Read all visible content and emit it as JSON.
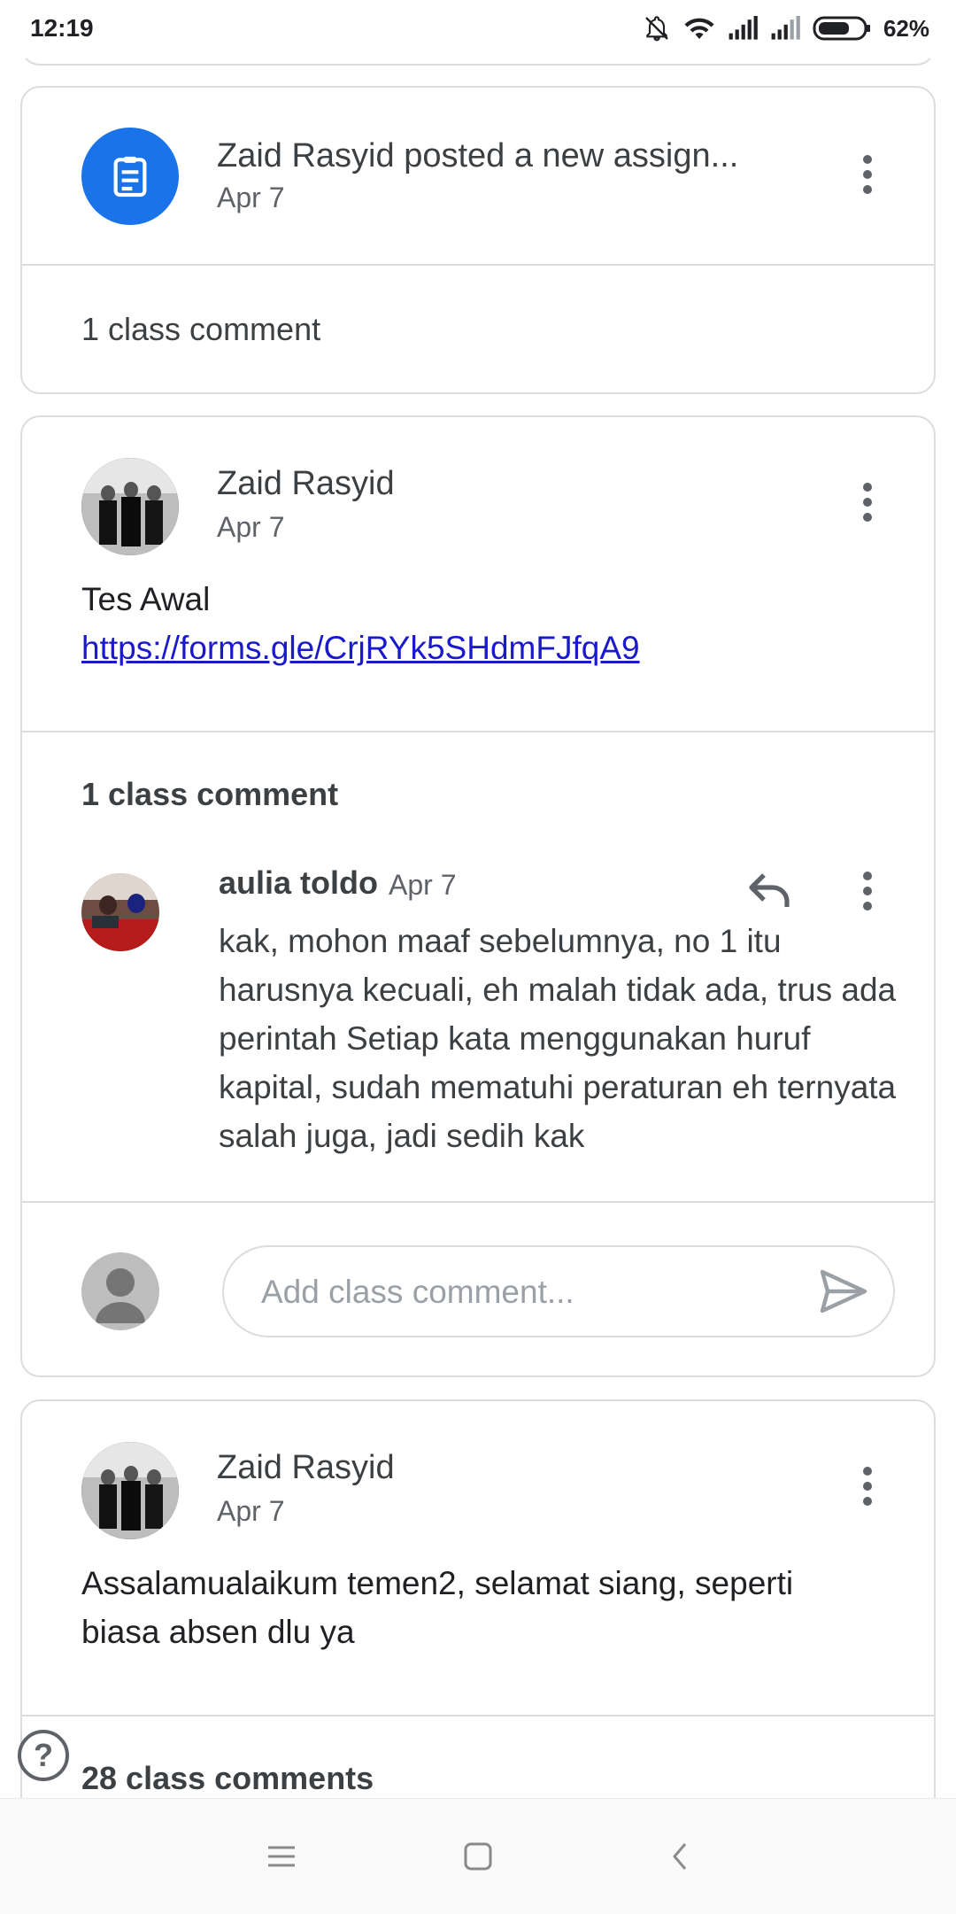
{
  "status_bar": {
    "time": "12:19",
    "battery": "62%"
  },
  "posts": [
    {
      "author_line": "Zaid Rasyid posted a new assign...",
      "date": "Apr 7",
      "comments_label": "1 class comment"
    },
    {
      "author": "Zaid Rasyid",
      "date": "Apr 7",
      "body_line1": "Tes Awal",
      "link": "https://forms.gle/CrjRYk5SHdmFJfqA9",
      "comments_label": "1 class comment",
      "comment": {
        "author": "aulia toldo",
        "date": "Apr 7",
        "text": "kak, mohon maaf sebelumnya, no 1 itu harusnya kecuali, eh malah tidak ada, trus ada perintah Setiap kata menggunakan huruf kapital, sudah mematuhi peraturan eh ternyata salah juga, jadi sedih kak"
      },
      "input_placeholder": "Add class comment..."
    },
    {
      "author": "Zaid Rasyid",
      "date": "Apr 7",
      "body": "Assalamualaikum temen2, selamat siang, seperti biasa absen dlu ya",
      "comments_label": "28 class comments"
    }
  ],
  "help": "?",
  "colors": {
    "accent": "#1a73e8",
    "border": "#dadce0",
    "text": "#3c4043",
    "muted": "#5f6368"
  }
}
